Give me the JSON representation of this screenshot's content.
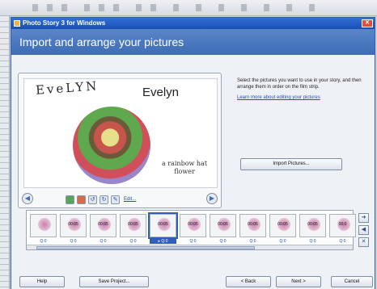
{
  "window": {
    "title": "Photo Story 3 for Windows",
    "close_glyph": "✕"
  },
  "header": {
    "title": "Import and arrange your pictures"
  },
  "preview": {
    "handwritten_name": "EveLYN",
    "typed_name": "Evelyn",
    "caption_line1": "a rainbow hat",
    "caption_line2": "flower",
    "nav_left_glyph": "◀",
    "nav_right_glyph": "▶",
    "edit_label": "Edit..."
  },
  "right_panel": {
    "instructions": "Select the pictures you want to use in your story, and then arrange them in order on the film strip.",
    "learn_link": "Learn more about editing your pictures",
    "import_button": "Import Pictures..."
  },
  "filmstrip": {
    "items": [
      {
        "duration": "",
        "label": "Q:0"
      },
      {
        "duration": "00:05",
        "label": "Q:0"
      },
      {
        "duration": "00:05",
        "label": "Q:0"
      },
      {
        "duration": "00:05",
        "label": "Q:0"
      },
      {
        "duration": "00:05",
        "label": "▸ Q:0"
      },
      {
        "duration": "00:05",
        "label": "Q:0"
      },
      {
        "duration": "00:05",
        "label": "Q:0"
      },
      {
        "duration": "00:05",
        "label": "Q:0"
      },
      {
        "duration": "00:05",
        "label": "Q:0"
      },
      {
        "duration": "00:05",
        "label": "Q:0"
      },
      {
        "duration": "00:0",
        "label": "Q:0"
      }
    ],
    "selected_index": 4,
    "up_glyph": "➜",
    "left_glyph": "◀",
    "remove_glyph": "✕"
  },
  "buttons": {
    "help": "Help",
    "save": "Save Project...",
    "back": "< Back",
    "next": "Next >",
    "cancel": "Cancel"
  }
}
